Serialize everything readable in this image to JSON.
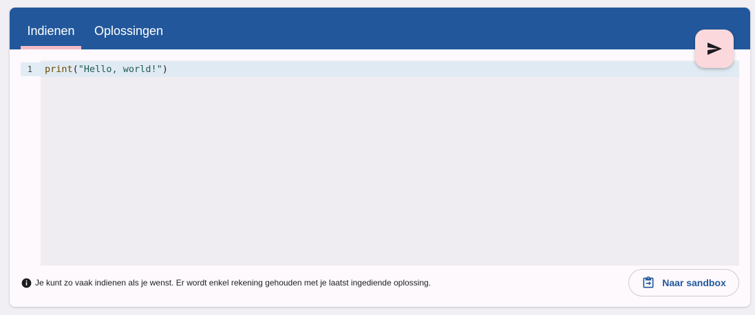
{
  "tabs": {
    "submit_label": "Indienen",
    "solutions_label": "Oplossingen"
  },
  "editor": {
    "line_numbers": [
      "1"
    ],
    "code": {
      "fn": "print",
      "open": "(",
      "string": "\"Hello, world!\"",
      "close": ")"
    }
  },
  "footer": {
    "info_text": "Je kunt zo vaak indienen als je wenst. Er wordt enkel rekening gehouden met je laatst ingediende oplossing.",
    "sandbox_label": "Naar sandbox"
  },
  "icons": {
    "submit": "send-icon",
    "info": "info-icon",
    "sandbox": "clipboard-arrow-icon"
  },
  "colors": {
    "primary": "#22589b",
    "accent": "#f3bcc5",
    "fab": "#fbd8dc"
  }
}
